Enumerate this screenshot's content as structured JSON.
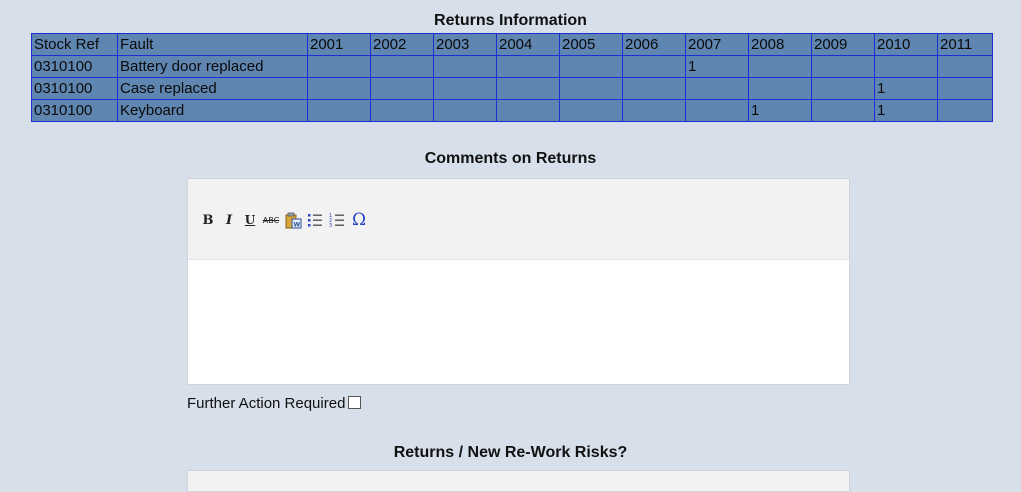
{
  "returns_info": {
    "title": "Returns Information",
    "headers": [
      "Stock Ref",
      "Fault",
      "2001",
      "2002",
      "2003",
      "2004",
      "2005",
      "2006",
      "2007",
      "2008",
      "2009",
      "2010",
      "2011"
    ],
    "rows": [
      [
        "0310100",
        "Battery door replaced",
        "",
        "",
        "",
        "",
        "",
        "",
        "1",
        "",
        "",
        "",
        ""
      ],
      [
        "0310100",
        "Case replaced",
        "",
        "",
        "",
        "",
        "",
        "",
        "",
        "",
        "",
        "1",
        ""
      ],
      [
        "0310100",
        "Keyboard",
        "",
        "",
        "",
        "",
        "",
        "",
        "",
        "1",
        "",
        "1",
        ""
      ]
    ]
  },
  "comments": {
    "title": "Comments on Returns",
    "toolbar": {
      "bold": "B",
      "italic": "I",
      "underline": "U",
      "strikethrough": "ABC",
      "paste_icon": "paste-word-icon",
      "bullet_icon": "bullet-list-icon",
      "number_icon": "numbered-list-icon",
      "special_char": "Ω"
    }
  },
  "further_action": {
    "label": "Further Action Required",
    "checked": false
  },
  "risks": {
    "title": "Returns / New Re-Work Risks?"
  }
}
